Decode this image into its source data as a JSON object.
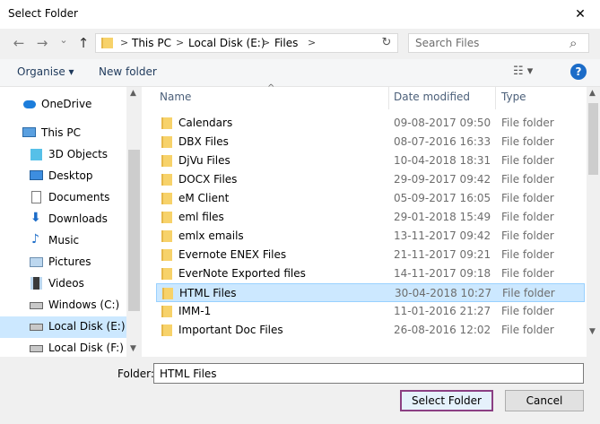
{
  "window": {
    "title": "Select Folder",
    "close_glyph": "✕"
  },
  "nav": {
    "back_glyph": "←",
    "forward_glyph": "→",
    "history_glyph": "⌄",
    "up_glyph": "↑",
    "breadcrumbs": [
      "This PC",
      "Local Disk (E:)",
      "Files"
    ],
    "crumb_separator": ">",
    "refresh_glyph": "↻",
    "search_placeholder": "Search Files",
    "search_glyph": "⌕"
  },
  "toolbar": {
    "organise_label": "Organise ▾",
    "new_folder_label": "New folder",
    "view_glyph": "☷ ▾",
    "help_glyph": "?"
  },
  "sidebar": {
    "items": [
      {
        "label": "OneDrive",
        "icon": "cloud-icon"
      },
      {
        "label": "This PC",
        "icon": "computer-icon"
      },
      {
        "label": "3D Objects",
        "icon": "cube-icon"
      },
      {
        "label": "Desktop",
        "icon": "desktop-icon"
      },
      {
        "label": "Documents",
        "icon": "document-icon"
      },
      {
        "label": "Downloads",
        "icon": "download-icon"
      },
      {
        "label": "Music",
        "icon": "music-icon"
      },
      {
        "label": "Pictures",
        "icon": "pictures-icon"
      },
      {
        "label": "Videos",
        "icon": "video-icon"
      },
      {
        "label": "Windows (C:)",
        "icon": "drive-icon"
      },
      {
        "label": "Local Disk (E:)",
        "icon": "drive-icon",
        "selected": true
      },
      {
        "label": "Local Disk (F:)",
        "icon": "drive-icon"
      }
    ]
  },
  "list": {
    "columns": {
      "name": "Name",
      "date": "Date modified",
      "type": "Type"
    },
    "sort_glyph": "^",
    "rows": [
      {
        "name": "Calendars",
        "date": "09-08-2017 09:50",
        "type": "File folder"
      },
      {
        "name": "DBX Files",
        "date": "08-07-2016 16:33",
        "type": "File folder"
      },
      {
        "name": "DjVu Files",
        "date": "10-04-2018 18:31",
        "type": "File folder"
      },
      {
        "name": "DOCX Files",
        "date": "29-09-2017 09:42",
        "type": "File folder"
      },
      {
        "name": "eM Client",
        "date": "05-09-2017 16:05",
        "type": "File folder"
      },
      {
        "name": "eml files",
        "date": "29-01-2018 15:49",
        "type": "File folder"
      },
      {
        "name": "emlx emails",
        "date": "13-11-2017 09:42",
        "type": "File folder"
      },
      {
        "name": "Evernote ENEX Files",
        "date": "21-11-2017 09:21",
        "type": "File folder"
      },
      {
        "name": "EverNote Exported files",
        "date": "14-11-2017 09:18",
        "type": "File folder"
      },
      {
        "name": "HTML Files",
        "date": "30-04-2018 10:27",
        "type": "File folder",
        "selected": true
      },
      {
        "name": "IMM-1",
        "date": "11-01-2016 21:27",
        "type": "File folder"
      },
      {
        "name": "Important Doc Files",
        "date": "26-08-2016 12:02",
        "type": "File folder"
      }
    ]
  },
  "footer": {
    "folder_label": "Folder:",
    "folder_value": "HTML Files",
    "select_label": "Select Folder",
    "cancel_label": "Cancel"
  },
  "colors": {
    "selection": "#cce8ff",
    "folder": "#f7d26a",
    "link": "#1e395b"
  }
}
